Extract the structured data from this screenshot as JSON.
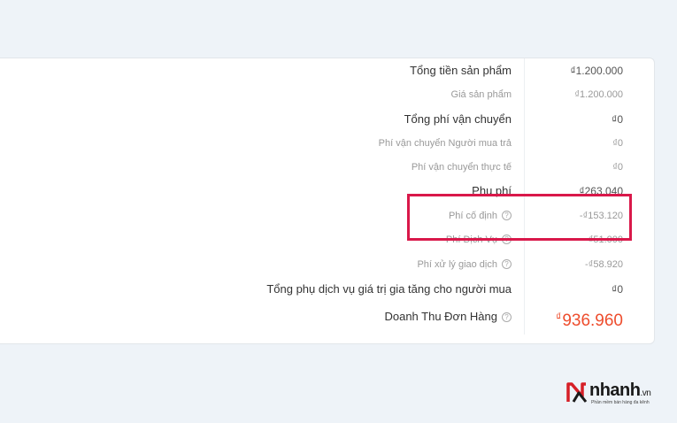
{
  "summary": {
    "rows": [
      {
        "label": "Tổng tiền sản phẩm",
        "value": "₫1.200.000",
        "type": "main",
        "help": false
      },
      {
        "label": "Giá sản phẩm",
        "value": "₫1.200.000",
        "type": "sub",
        "help": false
      },
      {
        "label": "Tổng phí vận chuyển",
        "value": "₫0",
        "type": "main",
        "help": false
      },
      {
        "label": "Phí vận chuyển Người mua trả",
        "value": "₫0",
        "type": "sub",
        "help": false
      },
      {
        "label": "Phí vận chuyển thực tế",
        "value": "₫0",
        "type": "sub",
        "help": false
      },
      {
        "label": "Phụ phí",
        "value": "₫263.040",
        "type": "main",
        "help": false
      },
      {
        "label": "Phí cố định",
        "value": "-₫153.120",
        "type": "sub",
        "help": true
      },
      {
        "label": "Phí Dịch Vụ",
        "value": "-₫51.000",
        "type": "sub",
        "help": true
      },
      {
        "label": "Phí xử lý giao dịch",
        "value": "-₫58.920",
        "type": "sub",
        "help": true
      },
      {
        "label": "Tổng phụ dịch vụ giá trị gia tăng cho người mua",
        "value": "₫0",
        "type": "main",
        "help": false
      }
    ],
    "revenue": {
      "label": "Doanh Thu Đơn Hàng",
      "currency": "₫",
      "amount": "936.960",
      "color": "#ee4d2d"
    }
  },
  "help_icon_glyph": "?",
  "logo": {
    "brand": "nhanh",
    "tld": ".vn",
    "tagline": "Phần mềm bán hàng đa kênh"
  },
  "colors": {
    "highlight": "#d9184a",
    "accent": "#ee4d2d",
    "background": "#eef3f8"
  }
}
